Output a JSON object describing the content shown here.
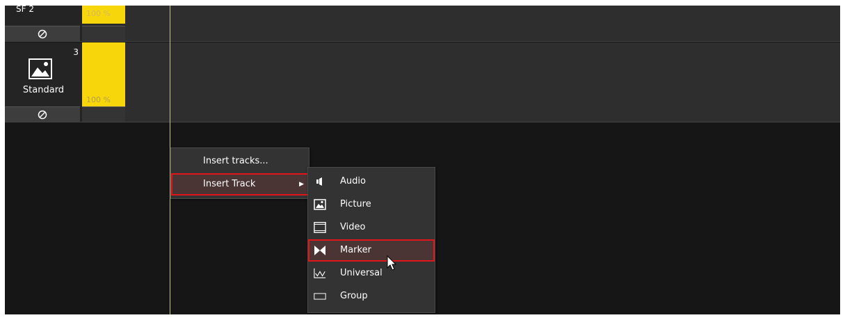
{
  "tracks": [
    {
      "name": "SF  2",
      "volume": "100 %",
      "volume_fraction": 0.5
    },
    {
      "number": "3",
      "label": "Standard",
      "volume": "100 %",
      "volume_fraction": 1.0,
      "icon": "picture-icon"
    }
  ],
  "context_menu": {
    "items": [
      {
        "label": "Insert tracks..."
      },
      {
        "label": "Insert Track",
        "has_submenu": true,
        "highlighted": true
      }
    ]
  },
  "submenu": {
    "items": [
      {
        "label": "Audio",
        "icon": "audio-icon"
      },
      {
        "label": "Picture",
        "icon": "picture-icon"
      },
      {
        "label": "Video",
        "icon": "video-icon"
      },
      {
        "label": "Marker",
        "icon": "marker-icon",
        "highlighted": true
      },
      {
        "label": "Universal",
        "icon": "universal-icon"
      },
      {
        "label": "Group",
        "icon": "group-icon"
      }
    ]
  },
  "colors": {
    "volume_fill": "#f7d70b",
    "highlight_border": "#e0161b",
    "menu_bg": "#333333"
  }
}
